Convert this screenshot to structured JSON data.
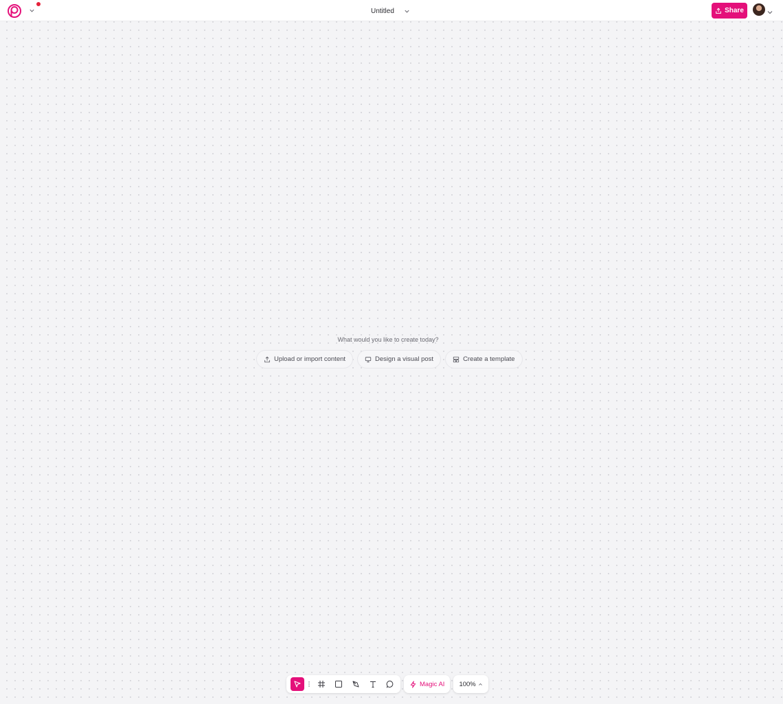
{
  "header": {
    "title": "Untitled",
    "share_label": "Share",
    "brand_color": "#e4107a",
    "notification_color": "#e5213a",
    "icons": [
      "logo-icon",
      "chevron-down-icon",
      "share-icon",
      "avatar"
    ]
  },
  "canvas": {
    "prompt": "What would you like to create today?",
    "actions": [
      {
        "label": "Upload or import content",
        "icon": "upload-icon"
      },
      {
        "label": "Design a visual post",
        "icon": "monitor-icon"
      },
      {
        "label": "Create a template",
        "icon": "template-icon"
      }
    ]
  },
  "toolbar": {
    "tools": [
      "select-icon",
      "frame-icon",
      "rectangle-icon",
      "pen-icon",
      "text-icon",
      "comment-icon"
    ],
    "active_tool": "select-icon",
    "magic_label": "Magic AI",
    "zoom_label": "100%"
  }
}
